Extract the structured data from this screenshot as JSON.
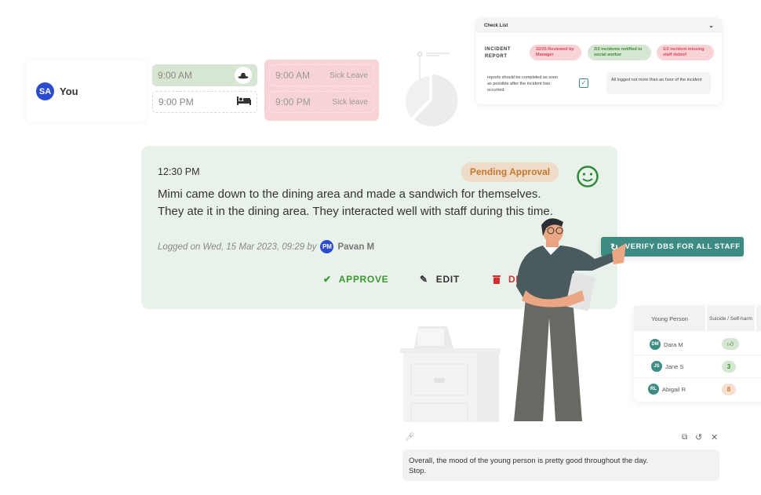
{
  "shift": {
    "user": {
      "initials": "SA",
      "name": "You",
      "avatar_color": "#2a4bd0"
    },
    "slots": [
      {
        "time": "9:00 AM",
        "icon": "hat-icon",
        "state": "green"
      },
      {
        "time": "9:00 PM",
        "icon": "bed-icon",
        "state": "empty"
      }
    ],
    "leave": [
      {
        "time": "9:00 AM",
        "label": "Sick Leave"
      },
      {
        "time": "9:00 PM",
        "label": "Sick leave"
      }
    ]
  },
  "checklist": {
    "title": "Check List",
    "section": "INCIDENT REPORT",
    "pills": [
      {
        "text": "32/35 Reviewed by Manager",
        "status": "red"
      },
      {
        "text": "2/2 incidents notified to social worker",
        "status": "green"
      },
      {
        "text": "1/2 incident missing staff debref",
        "status": "red"
      }
    ],
    "requirement": "reports should be completed as soon as possible after the incident has occurred",
    "checked": true,
    "note": "All logged not more than an hour of the incident"
  },
  "log": {
    "time": "12:30 PM",
    "status": "Pending Approval",
    "mood_icon": "smiley-icon",
    "text": "Mimi came down to the dining area and made a sandwich for themselves. They ate it in the dining area. They interacted well with staff during this time.",
    "logged": "Logged on Wed, 15 Mar 2023, 09:29 by",
    "author_initials": "PM",
    "author": "Pavan M",
    "actions": {
      "approve": "APPROVE",
      "edit": "EDIT",
      "delete": "DE"
    }
  },
  "verify_button": "VERIFY DBS FOR ALL STAFF",
  "table": {
    "headers": [
      "Young Person",
      "Suicide / Self-harm"
    ],
    "rows": [
      {
        "initials": "DM",
        "name": "Dara M",
        "value": "",
        "icon": "thumbs-up-icon",
        "tone": "green"
      },
      {
        "initials": "JS",
        "name": "Jane S",
        "value": "3",
        "tone": "green"
      },
      {
        "initials": "RL",
        "name": "Abigail R",
        "value": "8",
        "tone": "orange"
      }
    ]
  },
  "voice": {
    "text_line1": "Overall, the mood of the young person is pretty good throughout the day.",
    "text_line2": "Stop."
  },
  "colors": {
    "accent": "#3d8c84",
    "approve": "#3a9a2f",
    "delete": "#d32f2f",
    "pending": "#c7782f"
  }
}
